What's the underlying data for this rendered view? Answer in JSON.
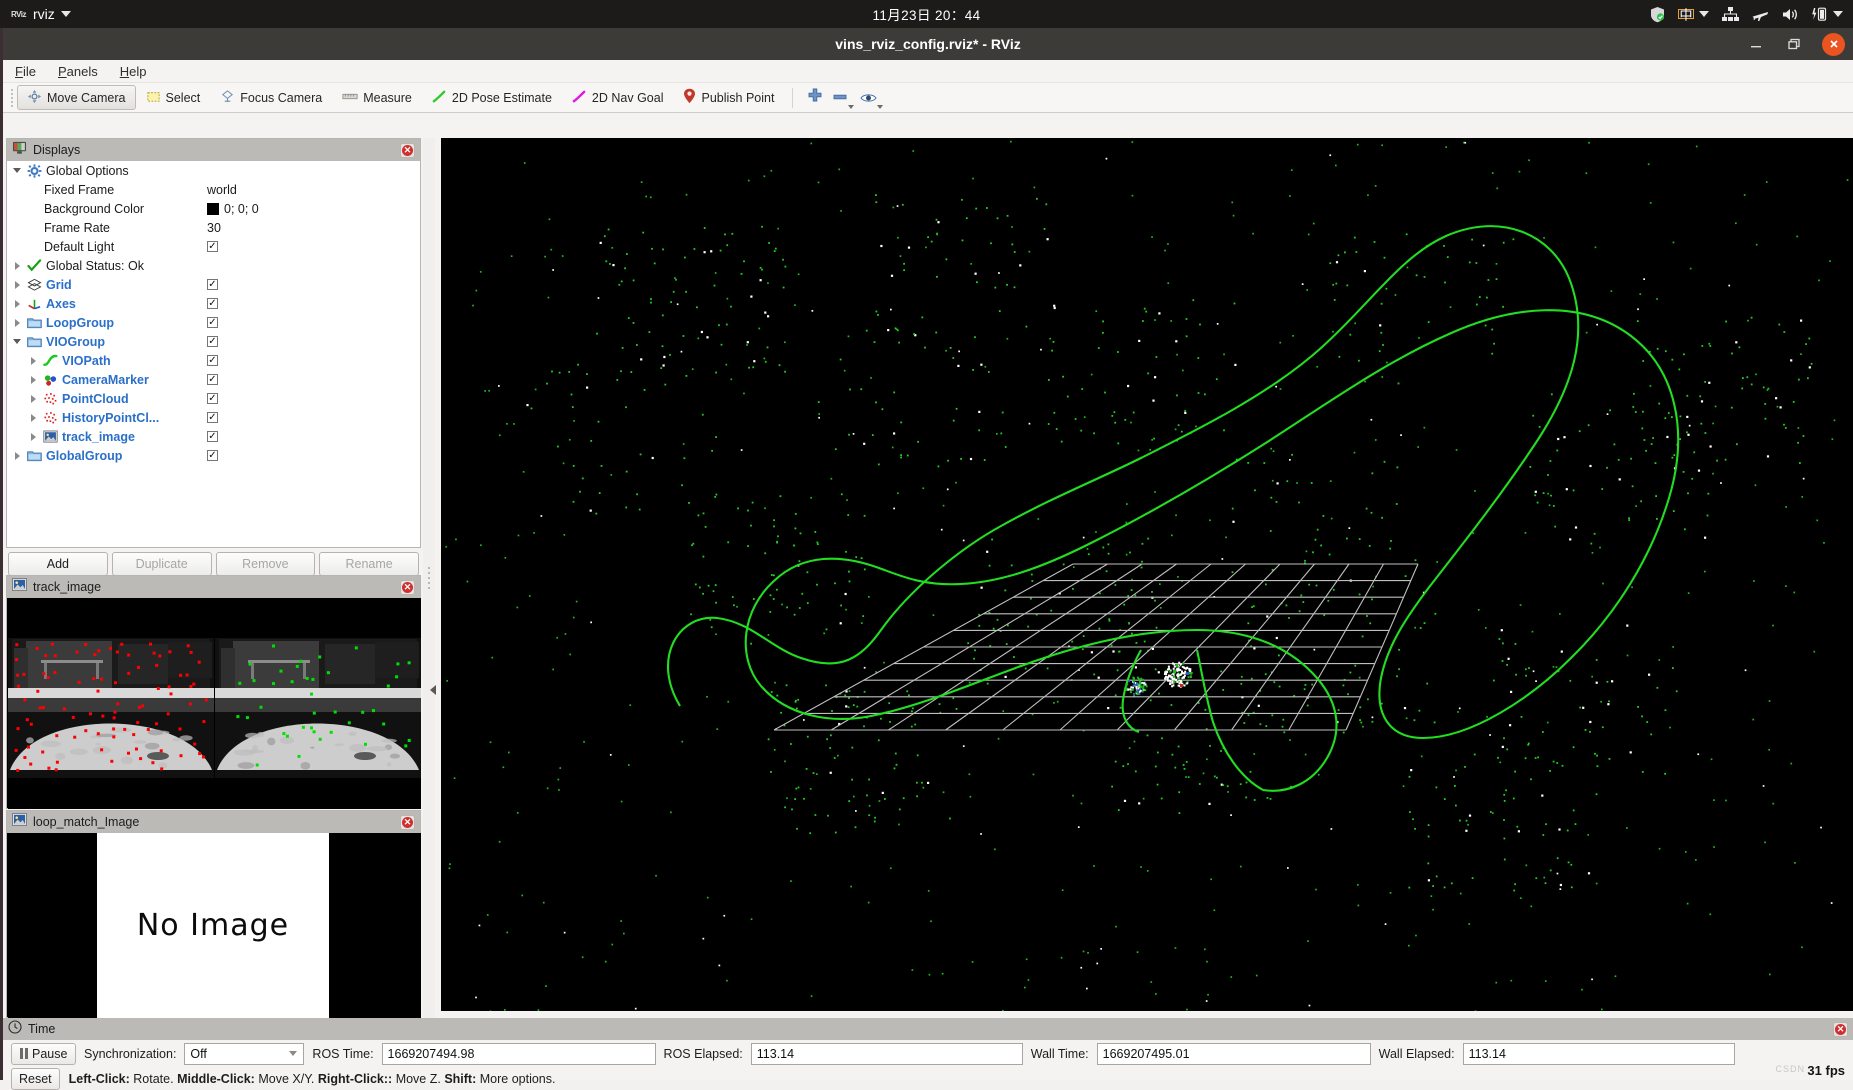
{
  "ubuntu_bar": {
    "app_name": "rviz",
    "app_icon": "rviz-logo-icon",
    "clock": "11月23日  20：44",
    "tray": [
      "shield-icon",
      "input-method-zh-icon",
      "network-icon",
      "airplane-mode-icon",
      "volume-icon",
      "battery-icon"
    ],
    "input_method_label": "中"
  },
  "window": {
    "title": "vins_rviz_config.rviz* - RViz",
    "minimize_label": "—",
    "maximize_label": "❐",
    "close_label": "✕"
  },
  "menubar": [
    {
      "label": "File",
      "accel": "F"
    },
    {
      "label": "Panels",
      "accel": "P"
    },
    {
      "label": "Help",
      "accel": "H"
    }
  ],
  "toolbar": {
    "buttons": [
      {
        "label": "Move Camera",
        "icon": "move-camera-icon",
        "active": true
      },
      {
        "label": "Select",
        "icon": "select-rect-icon",
        "active": false
      },
      {
        "label": "Focus Camera",
        "icon": "focus-camera-icon",
        "active": false
      },
      {
        "label": "Measure",
        "icon": "measure-ruler-icon",
        "active": false
      },
      {
        "label": "2D Pose Estimate",
        "icon": "pose-estimate-arrow-icon",
        "active": false
      },
      {
        "label": "2D Nav Goal",
        "icon": "nav-goal-arrow-icon",
        "active": false
      },
      {
        "label": "Publish Point",
        "icon": "publish-point-pin-icon",
        "active": false
      }
    ],
    "icon_buttons": [
      "plus-icon",
      "minus-icon",
      "eye-icon"
    ]
  },
  "displays_panel": {
    "title": "Displays",
    "icon": "displays-monitor-icon",
    "close_icon": "close-icon",
    "tree": [
      {
        "indent": 0,
        "twisty": "down",
        "icon": "gear-icon",
        "label": "Global Options",
        "bold": false,
        "value_type": "none"
      },
      {
        "indent": 1,
        "twisty": "none",
        "icon": "none",
        "label": "Fixed Frame",
        "bold": false,
        "value_type": "text",
        "value": "world"
      },
      {
        "indent": 1,
        "twisty": "none",
        "icon": "none",
        "label": "Background Color",
        "bold": false,
        "value_type": "color",
        "value": "0; 0; 0",
        "swatch": "#000000"
      },
      {
        "indent": 1,
        "twisty": "none",
        "icon": "none",
        "label": "Frame Rate",
        "bold": false,
        "value_type": "text",
        "value": "30"
      },
      {
        "indent": 1,
        "twisty": "none",
        "icon": "none",
        "label": "Default Light",
        "bold": false,
        "value_type": "checkbox",
        "checked": true
      },
      {
        "indent": 0,
        "twisty": "right",
        "icon": "check-ok-icon",
        "label": "Global Status: Ok",
        "bold": false,
        "value_type": "none"
      },
      {
        "indent": 0,
        "twisty": "right",
        "icon": "grid-icon",
        "label": "Grid",
        "bold": true,
        "value_type": "checkbox",
        "checked": true
      },
      {
        "indent": 0,
        "twisty": "right",
        "icon": "axes-icon",
        "label": "Axes",
        "bold": true,
        "value_type": "checkbox",
        "checked": true
      },
      {
        "indent": 0,
        "twisty": "right",
        "icon": "folder-icon",
        "label": "LoopGroup",
        "bold": true,
        "value_type": "checkbox",
        "checked": true
      },
      {
        "indent": 0,
        "twisty": "down",
        "icon": "folder-icon",
        "label": "VIOGroup",
        "bold": true,
        "value_type": "checkbox",
        "checked": true
      },
      {
        "indent": 1,
        "twisty": "right",
        "icon": "path-curve-icon",
        "label": "VIOPath",
        "bold": true,
        "value_type": "checkbox",
        "checked": true
      },
      {
        "indent": 1,
        "twisty": "right",
        "icon": "marker-spheres-icon",
        "label": "CameraMarker",
        "bold": true,
        "value_type": "checkbox",
        "checked": true
      },
      {
        "indent": 1,
        "twisty": "right",
        "icon": "pointcloud-icon",
        "label": "PointCloud",
        "bold": true,
        "value_type": "checkbox",
        "checked": true
      },
      {
        "indent": 1,
        "twisty": "right",
        "icon": "pointcloud-icon",
        "label": "HistoryPointCl...",
        "bold": true,
        "value_type": "checkbox",
        "checked": true
      },
      {
        "indent": 1,
        "twisty": "right",
        "icon": "image-icon",
        "label": "track_image",
        "bold": true,
        "value_type": "checkbox",
        "checked": true
      },
      {
        "indent": 0,
        "twisty": "right",
        "icon": "folder-icon",
        "label": "GlobalGroup",
        "bold": true,
        "value_type": "checkbox",
        "checked": true
      }
    ],
    "buttons": [
      {
        "label": "Add",
        "disabled": false
      },
      {
        "label": "Duplicate",
        "disabled": true
      },
      {
        "label": "Remove",
        "disabled": true
      },
      {
        "label": "Rename",
        "disabled": true
      }
    ]
  },
  "track_image_panel": {
    "title": "track_image",
    "icon": "image-icon",
    "close_icon": "close-icon"
  },
  "loop_match_panel": {
    "title": "loop_match_Image",
    "icon": "image-icon",
    "close_icon": "close-icon",
    "placeholder_text": "No Image"
  },
  "view3d": {
    "background_color": "#000000",
    "grid_color": "#bfbfbf",
    "path_color": "#22dd22",
    "point_colors": [
      "#22cc22",
      "#ffffff"
    ],
    "grid_cells": 10
  },
  "time_panel": {
    "title": "Time",
    "icon": "clock-icon",
    "close_icon": "close-icon",
    "pause_label": "Pause",
    "sync_label": "Synchronization:",
    "sync_value": "Off",
    "ros_time_label": "ROS Time:",
    "ros_time_value": "1669207494.98",
    "ros_elapsed_label": "ROS Elapsed:",
    "ros_elapsed_value": "113.14",
    "wall_time_label": "Wall Time:",
    "wall_time_value": "1669207495.01",
    "wall_elapsed_label": "Wall Elapsed:",
    "wall_elapsed_value": "113.14",
    "reset_label": "Reset",
    "hint_left": "Left-Click:",
    "hint_left_val": "Rotate.",
    "hint_mid": "Middle-Click:",
    "hint_mid_val": "Move X/Y.",
    "hint_right": "Right-Click::",
    "hint_right_val": "Move Z.",
    "hint_shift": "Shift:",
    "hint_shift_val": "More options.",
    "fps": "31 fps",
    "watermark": "CSDN"
  }
}
